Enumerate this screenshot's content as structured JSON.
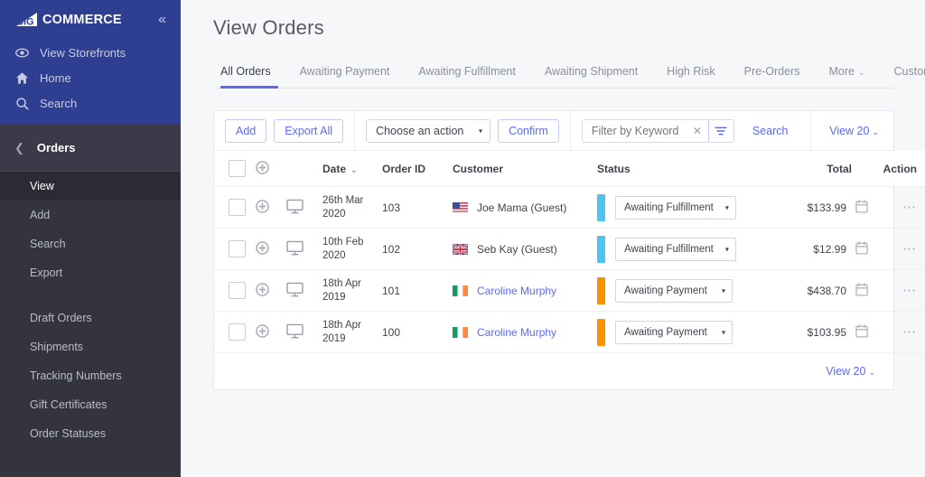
{
  "sidebar": {
    "brand": {
      "mark": "bigcommerce-logo-icon",
      "text": "COMMERCE",
      "big": "BIG"
    },
    "collapse_label": "«",
    "top_nav": [
      {
        "icon": "eye-icon",
        "label": "View Storefronts"
      },
      {
        "icon": "home-icon",
        "label": "Home"
      },
      {
        "icon": "search-icon",
        "label": "Search"
      }
    ],
    "section": {
      "back_icon": "chevron-left-icon",
      "title": "Orders"
    },
    "links_group_1": [
      {
        "label": "View",
        "active": true
      },
      {
        "label": "Add",
        "active": false
      },
      {
        "label": "Search",
        "active": false
      },
      {
        "label": "Export",
        "active": false
      }
    ],
    "links_group_2": [
      {
        "label": "Draft Orders"
      },
      {
        "label": "Shipments"
      },
      {
        "label": "Tracking Numbers"
      },
      {
        "label": "Gift Certificates"
      },
      {
        "label": "Order Statuses"
      }
    ]
  },
  "page": {
    "title": "View Orders"
  },
  "tabs": [
    {
      "label": "All Orders",
      "active": true,
      "caret": ""
    },
    {
      "label": "Awaiting Payment",
      "active": false,
      "caret": ""
    },
    {
      "label": "Awaiting Fulfillment",
      "active": false,
      "caret": ""
    },
    {
      "label": "Awaiting Shipment",
      "active": false,
      "caret": ""
    },
    {
      "label": "High Risk",
      "active": false,
      "caret": ""
    },
    {
      "label": "Pre-Orders",
      "active": false,
      "caret": ""
    },
    {
      "label": "More",
      "active": false,
      "caret": "⌄"
    },
    {
      "label": "Custom Views",
      "active": false,
      "caret": ""
    }
  ],
  "toolbar": {
    "add_label": "Add",
    "export_all_label": "Export All",
    "action_select_value": "Choose an action",
    "action_select_arrow": "▾",
    "confirm_label": "Confirm",
    "filter_placeholder": "Filter by Keyword",
    "filter_value": "",
    "filter_clear_icon": "close-icon",
    "filter_icon": "filter-icon",
    "search_label": "Search",
    "view_count_label": "View 20",
    "view_caret": "⌄"
  },
  "table": {
    "headers": {
      "checkbox": "select-all-checkbox",
      "expand": "expand-all-icon",
      "device": "",
      "date": "Date",
      "date_sort_caret": "⌄",
      "order_id": "Order ID",
      "customer": "Customer",
      "status": "Status",
      "total": "Total",
      "action": "Action"
    },
    "rows": [
      {
        "checked": false,
        "expand_icon": "plus-circle-icon",
        "device_icon": "desktop-icon",
        "date_line1": "26th Mar",
        "date_line2": "2020",
        "order_id": "103",
        "flag": "us-flag-icon",
        "customer": "Joe Mama (Guest)",
        "customer_is_link": false,
        "status": "Awaiting Fulfillment",
        "status_color": "#4FC4F0",
        "status_arrow": "▾",
        "total": "$133.99",
        "calendar_icon": "calendar-icon",
        "more_icon": "more-horizontal-icon"
      },
      {
        "checked": false,
        "expand_icon": "plus-circle-icon",
        "device_icon": "desktop-icon",
        "date_line1": "10th Feb",
        "date_line2": "2020",
        "order_id": "102",
        "flag": "uk-flag-icon",
        "customer": "Seb Kay (Guest)",
        "customer_is_link": false,
        "status": "Awaiting Fulfillment",
        "status_color": "#4FC4F0",
        "status_arrow": "▾",
        "total": "$12.99",
        "calendar_icon": "calendar-icon",
        "more_icon": "more-horizontal-icon"
      },
      {
        "checked": false,
        "expand_icon": "plus-circle-icon",
        "device_icon": "desktop-icon",
        "date_line1": "18th Apr",
        "date_line2": "2019",
        "order_id": "101",
        "flag": "ireland-flag-icon",
        "customer": "Caroline Murphy",
        "customer_is_link": true,
        "status": "Awaiting Payment",
        "status_color": "#FB9200",
        "status_arrow": "▾",
        "total": "$438.70",
        "calendar_icon": "calendar-icon",
        "more_icon": "more-horizontal-icon"
      },
      {
        "checked": false,
        "expand_icon": "plus-circle-icon",
        "device_icon": "desktop-icon",
        "date_line1": "18th Apr",
        "date_line2": "2019",
        "order_id": "100",
        "flag": "ireland-flag-icon",
        "customer": "Caroline Murphy",
        "customer_is_link": true,
        "status": "Awaiting Payment",
        "status_color": "#FB9200",
        "status_arrow": "▾",
        "total": "$103.95",
        "calendar_icon": "calendar-icon",
        "more_icon": "more-horizontal-icon"
      }
    ]
  },
  "footer": {
    "view_count_label": "View 20",
    "view_caret": "⌄"
  },
  "colors": {
    "sidebar_top": "#2e3e91",
    "sidebar_body": "#34343f",
    "accent": "#5a6af4",
    "status_fulfillment": "#4FC4F0",
    "status_payment": "#FB9200",
    "page_bg": "#f6f7f9"
  }
}
